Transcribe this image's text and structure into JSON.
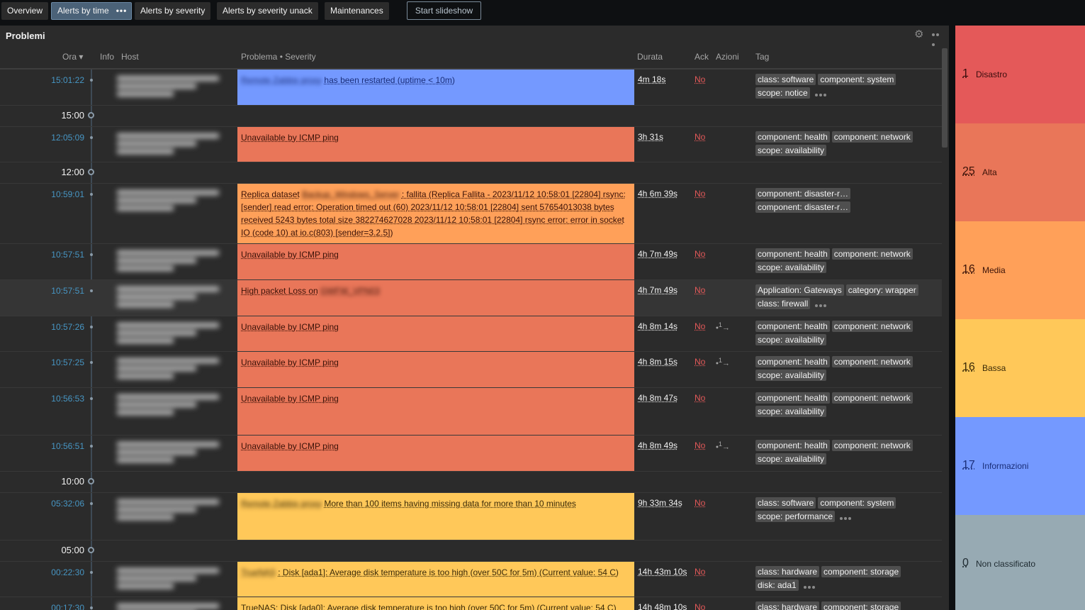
{
  "tabs": [
    {
      "label": "Overview"
    },
    {
      "label": "Alerts by time"
    },
    {
      "label": "Alerts by severity"
    },
    {
      "label": "Alerts by severity unack"
    },
    {
      "label": "Maintenances"
    }
  ],
  "slideshow_label": "Start slideshow",
  "widget": {
    "title": "Problemi",
    "headers": {
      "time": "Ora ▾",
      "info": "Info",
      "host": "Host",
      "problem": "Problema • Severity",
      "duration": "Durata",
      "ack": "Ack",
      "actions": "Azioni",
      "tags": "Tag"
    },
    "time_marks": [
      "15:00",
      "12:00",
      "10:00",
      "05:00"
    ],
    "rows": [
      {
        "time": "15:01:22",
        "problem": "has been restarted (uptime < 10m)",
        "problem_blur": "Remote Zabbix proxy",
        "duration": "4m 18s",
        "ack": "No",
        "tags": [
          "class: software",
          "component: system",
          "scope: notice"
        ]
      },
      {
        "time": "12:05:09",
        "problem": "Unavailable by ICMP ping",
        "duration": "3h 31s",
        "ack": "No",
        "tags": [
          "component: health",
          "component: network",
          "scope: availability"
        ]
      },
      {
        "time": "10:59:01",
        "problem_prefix": "Replica dataset",
        "problem_blur": "Backup_Windows_Server",
        "problem": ": fallita (Replica Fallita - 2023/11/12 10:58:01 [22804] rsync: [sender] read error: Operation timed out (60) 2023/11/12 10:58:01 [22804] sent 57654013038 bytes  received 5243 bytes  total size 382274627028 2023/11/12 10:58:01 [22804] rsync error: error in socket IO (code 10) at io.c(803) [sender=3.2.5])",
        "duration": "4h 6m 39s",
        "ack": "No",
        "tags": [
          "component: disaster-r…",
          "component: disaster-r…"
        ]
      },
      {
        "time": "10:57:51",
        "problem": "Unavailable by ICMP ping",
        "duration": "4h 7m 49s",
        "ack": "No",
        "tags": [
          "component: health",
          "component: network",
          "scope: availability"
        ]
      },
      {
        "time": "10:57:51",
        "problem": "High packet Loss on",
        "problem_blur": "GWFW_VPN03",
        "duration": "4h 7m 49s",
        "ack": "No",
        "tags": [
          "Application: Gateways",
          "category: wrapper",
          "class: firewall"
        ]
      },
      {
        "time": "10:57:26",
        "problem": "Unavailable by ICMP ping",
        "duration": "4h 8m 14s",
        "ack": "No",
        "action": "1",
        "tags": [
          "component: health",
          "component: network",
          "scope: availability"
        ]
      },
      {
        "time": "10:57:25",
        "problem": "Unavailable by ICMP ping",
        "duration": "4h 8m 15s",
        "ack": "No",
        "action": "1",
        "tags": [
          "component: health",
          "component: network",
          "scope: availability"
        ]
      },
      {
        "time": "10:56:53",
        "problem": "Unavailable by ICMP ping",
        "duration": "4h 8m 47s",
        "ack": "No",
        "tags": [
          "component: health",
          "component: network",
          "scope: availability"
        ]
      },
      {
        "time": "10:56:51",
        "problem": "Unavailable by ICMP ping",
        "duration": "4h 8m 49s",
        "ack": "No",
        "action": "1",
        "tags": [
          "component: health",
          "component: network",
          "scope: availability"
        ]
      },
      {
        "time": "05:32:06",
        "problem": "More than 100 items having missing data for more than 10 minutes",
        "problem_blur": "Remote Zabbix proxy",
        "duration": "9h 33m 34s",
        "ack": "No",
        "tags": [
          "class: software",
          "component: system",
          "scope: performance"
        ]
      },
      {
        "time": "00:22:30",
        "problem": ": Disk [ada1]: Average disk temperature is too high (over 50C for 5m) (Current value: 54 C)",
        "problem_blur": "TrueNAS",
        "duration": "14h 43m 10s",
        "ack": "No",
        "tags": [
          "class: hardware",
          "component: storage",
          "disk: ada1"
        ]
      },
      {
        "time": "00:17:30",
        "problem": "TrueNAS: Disk [ada0]: Average disk temperature is too high (over 50C for 5m) (Current value: 54 C)",
        "duration": "14h 48m 10s",
        "ack": "No",
        "tags": [
          "class: hardware",
          "component: storage"
        ]
      }
    ]
  },
  "severity": [
    {
      "count": "1",
      "label": "Disastro",
      "color": "#e45959"
    },
    {
      "count": "25",
      "label": "Alta",
      "color": "#e97659"
    },
    {
      "count": "16",
      "label": "Media",
      "color": "#ffa059"
    },
    {
      "count": "16",
      "label": "Bassa",
      "color": "#ffc859"
    },
    {
      "count": "17",
      "label": "Informazioni",
      "color": "#7499ff"
    },
    {
      "count": "0",
      "label": "Non classificato",
      "color": "#97aab3"
    }
  ]
}
